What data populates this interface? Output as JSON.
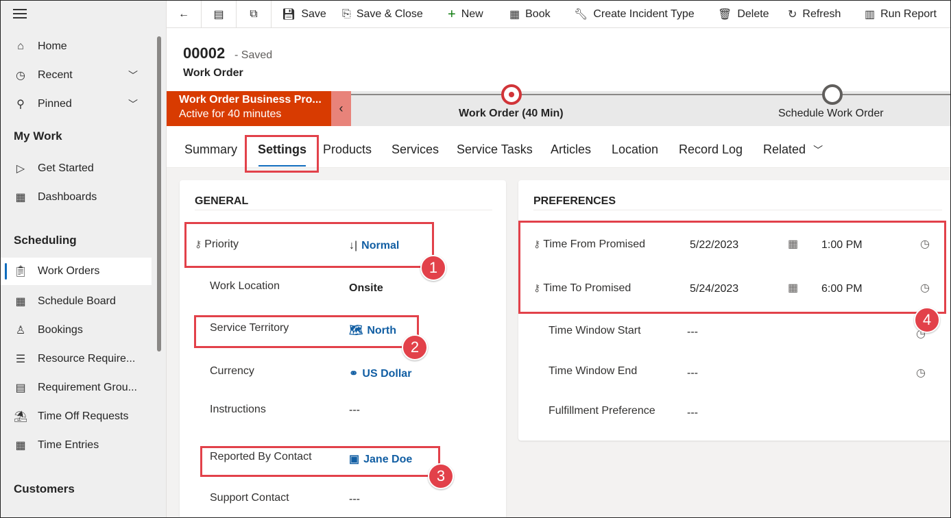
{
  "sidebar": {
    "items_top": [
      {
        "label": "Home",
        "icon": "home-icon"
      },
      {
        "label": "Recent",
        "icon": "clock-icon"
      },
      {
        "label": "Pinned",
        "icon": "pin-icon"
      }
    ],
    "my_work_heading": "My Work",
    "my_work": [
      {
        "label": "Get Started",
        "icon": "play-icon"
      },
      {
        "label": "Dashboards",
        "icon": "dashboard-icon"
      }
    ],
    "scheduling_heading": "Scheduling",
    "scheduling": [
      {
        "label": "Work Orders",
        "icon": "clipboard-icon"
      },
      {
        "label": "Schedule Board",
        "icon": "calendar-icon"
      },
      {
        "label": "Bookings",
        "icon": "people-icon"
      },
      {
        "label": "Resource Require...",
        "icon": "list-icon"
      },
      {
        "label": "Requirement Grou...",
        "icon": "card-icon"
      },
      {
        "label": "Time Off Requests",
        "icon": "beach-icon"
      },
      {
        "label": "Time Entries",
        "icon": "calendar-icon"
      }
    ],
    "customers_heading": "Customers"
  },
  "commandbar": {
    "save": "Save",
    "save_close": "Save & Close",
    "new": "New",
    "book": "Book",
    "create_incident": "Create Incident Type",
    "delete": "Delete",
    "refresh": "Refresh",
    "run_report": "Run Report"
  },
  "header": {
    "record_id": "00002",
    "saved_status": "- Saved",
    "entity": "Work Order"
  },
  "bpf": {
    "name": "Work Order Business Pro...",
    "duration": "Active for 40 minutes",
    "stage_active": "Work Order",
    "stage_active_time": "(40 Min)",
    "stage_next": "Schedule Work Order"
  },
  "tabs": [
    "Summary",
    "Settings",
    "Products",
    "Services",
    "Service Tasks",
    "Articles",
    "Location",
    "Record Log",
    "Related"
  ],
  "general": {
    "heading": "GENERAL",
    "priority_label": "Priority",
    "priority_value": "Normal",
    "work_location_label": "Work Location",
    "work_location_value": "Onsite",
    "territory_label": "Service Territory",
    "territory_value": "North",
    "currency_label": "Currency",
    "currency_value": "US Dollar",
    "instructions_label": "Instructions",
    "instructions_value": "---",
    "reported_label": "Reported By Contact",
    "reported_value": "Jane Doe",
    "support_label": "Support Contact",
    "support_value": "---"
  },
  "preferences": {
    "heading": "PREFERENCES",
    "from_label": "Time From Promised",
    "from_date": "5/22/2023",
    "from_time": "1:00 PM",
    "to_label": "Time To Promised",
    "to_date": "5/24/2023",
    "to_time": "6:00 PM",
    "window_start_label": "Time Window Start",
    "window_start_value": "---",
    "window_end_label": "Time Window End",
    "window_end_value": "---",
    "fulfillment_label": "Fulfillment Preference",
    "fulfillment_value": "---"
  },
  "annotations": [
    "1",
    "2",
    "3",
    "4"
  ],
  "colors": {
    "accent": "#0f6cbd",
    "bpf_flag": "#d83b01",
    "highlight": "#e2414a"
  }
}
